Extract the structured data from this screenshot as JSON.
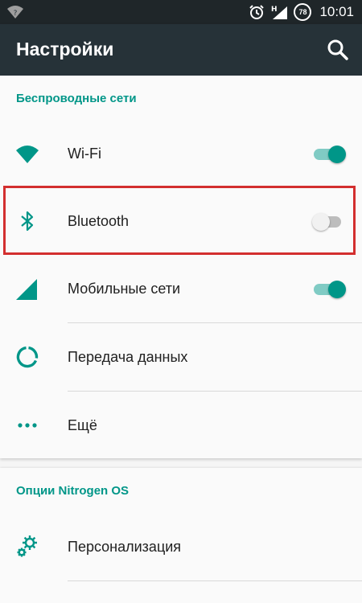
{
  "status_bar": {
    "time": "10:01",
    "battery_level": "78",
    "network_type": "H"
  },
  "app_bar": {
    "title": "Настройки",
    "search_icon": "search-icon"
  },
  "sections": [
    {
      "header": "Беспроводные сети",
      "items": [
        {
          "label": "Wi-Fi",
          "icon": "wifi-icon",
          "toggle": true
        },
        {
          "label": "Bluetooth",
          "icon": "bluetooth-icon",
          "toggle": false
        },
        {
          "label": "Мобильные сети",
          "icon": "cellular-signal-icon",
          "toggle": true
        },
        {
          "label": "Передача данных",
          "icon": "data-usage-icon"
        },
        {
          "label": "Ещё",
          "icon": "more-dots-icon"
        }
      ]
    },
    {
      "header": "Опции Nitrogen OS",
      "items": [
        {
          "label": "Персонализация",
          "icon": "gears-icon"
        }
      ]
    }
  ],
  "colors": {
    "accent": "#009688",
    "app_bar": "#263238",
    "status_bar": "#1f2629",
    "highlight_box": "#d32f2f"
  }
}
